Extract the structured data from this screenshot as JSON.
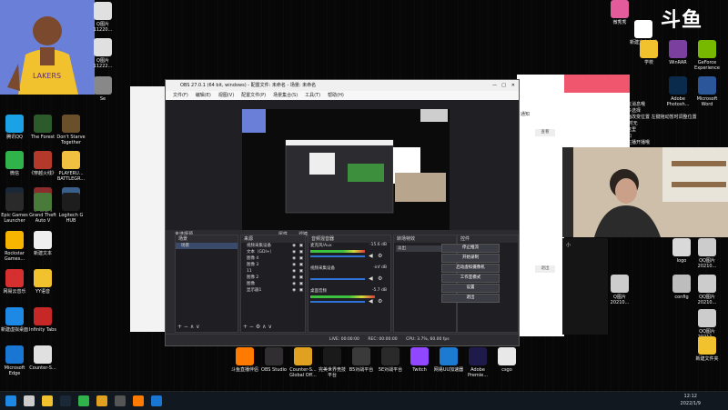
{
  "desktop": {
    "left_icons": [
      {
        "label": "腾讯QQ",
        "color": "#1aa1e6"
      },
      {
        "label": "The Forest",
        "color": "#2d5a2a"
      },
      {
        "label": "Don't Starve Together",
        "color": "#6a4f2b"
      },
      {
        "label": "微信",
        "color": "#2fb34a"
      },
      {
        "label": "《穿越火线》",
        "color": "#b33a2a"
      },
      {
        "label": "PLAYERU... BATTLEGR...",
        "color": "#f0c040"
      },
      {
        "label": "Steam",
        "color": "#1b2838"
      },
      {
        "label": "永劫无间",
        "color": "#8b2c2c"
      },
      {
        "label": "Raft",
        "color": "#3a5f8a"
      },
      {
        "label": "Epic Games Launcher",
        "color": "#2a2a2a"
      },
      {
        "label": "Grand Theft Auto V",
        "color": "#4a7a3a"
      },
      {
        "label": "Logitech G HUB",
        "color": "#1d1d1d"
      },
      {
        "label": "Rockstar Games...",
        "color": "#f7b500"
      },
      {
        "label": "新建文本",
        "color": "#eeeeee"
      },
      {
        "label": "网易云音乐",
        "color": "#d62f2f"
      },
      {
        "label": "YY语音",
        "color": "#f2c12e"
      },
      {
        "label": "新建虚拟桌面",
        "color": "#1e88e5"
      },
      {
        "label": "Infinity Tabs",
        "color": "#c62828"
      },
      {
        "label": "Microsoft Edge",
        "color": "#1976d2"
      },
      {
        "label": "Counter-S...",
        "color": "#e0e0e0"
      }
    ],
    "right_icons": [
      {
        "label": "Q图片 11220...",
        "color": "#e0e0e0"
      },
      {
        "label": "Q图片 11222...",
        "color": "#e0e0e0"
      },
      {
        "label": "Se",
        "color": "#888888"
      },
      {
        "label": "微秀秀",
        "color": "#e35b9a"
      },
      {
        "label": "新建文本文档",
        "color": "#ffffff"
      },
      {
        "label": "学校",
        "color": "#f2c12e"
      },
      {
        "label": "WinRAR",
        "color": "#7b3fa0"
      },
      {
        "label": "GeForce Experience",
        "color": "#76b900"
      },
      {
        "label": "图片编辑",
        "color": "#e53935"
      },
      {
        "label": "Adobe Photosh...",
        "color": "#0b2b4d"
      },
      {
        "label": "Microsoft Word",
        "color": "#2b579a"
      },
      {
        "label": "logo",
        "color": "#d9d9d9"
      },
      {
        "label": "QQ图片 20210...",
        "color": "#cccccc"
      },
      {
        "label": "config",
        "color": "#bdbdbd"
      },
      {
        "label": "QQ图片 20210...",
        "color": "#cccccc"
      },
      {
        "label": "Q图片 20210...",
        "color": "#cccccc"
      },
      {
        "label": "QQ图片 20211...",
        "color": "#cccccc"
      },
      {
        "label": "新建文件夹",
        "color": "#f2c12e"
      }
    ],
    "bottom_icons": [
      {
        "label": "斗鱼直播伴侣",
        "color": "#ff7a00"
      },
      {
        "label": "OBS Studio",
        "color": "#302e31"
      },
      {
        "label": "Counter-S... Global Off...",
        "color": "#e0a020"
      },
      {
        "label": "完美世界竞技 平台",
        "color": "#1a1a1a"
      },
      {
        "label": "B5对战平台",
        "color": "#3a3a3a"
      },
      {
        "label": "5E对战平台",
        "color": "#2a2a2a"
      },
      {
        "label": "Twitch",
        "color": "#9146ff"
      },
      {
        "label": "网易UU加速器",
        "color": "#1c7bd0"
      },
      {
        "label": "Adobe Premie...",
        "color": "#1e1a4a"
      },
      {
        "label": "csgo",
        "color": "#e8e8e8"
      }
    ]
  },
  "chat": {
    "lines": [
      "这里展示水友消息哦",
      "在侧边栏更多选择",
      "左侧进入页面改变位置 左键拖动暂时调整位置",
      "当前状态 暂时无",
      "还是展示在这里",
      "在线直播窗口",
      "开播后显示主播开播哦"
    ]
  },
  "brand": {
    "douyu": "斗鱼"
  },
  "obs": {
    "title": "OBS 27.0.1 (64 bit, windows) - 配置文件: 未命名 - 场景: 未命名",
    "menu": [
      "文件(F)",
      "编辑(E)",
      "视图(V)",
      "配置文件(P)",
      "场景集合(S)",
      "工具(T)",
      "帮助(H)"
    ],
    "no_source": "未选择源",
    "properties": "属性",
    "filters": "滤镜",
    "scenes_header": "场景",
    "scene_items": [
      "场景"
    ],
    "sources_header": "来源",
    "sources": [
      "视频采集设备",
      "文本（GDI+）",
      "图像 4",
      "图像 3",
      "11",
      "图像 2",
      "图像",
      "显示器1"
    ],
    "mixer_header": "音频混音器",
    "mixer": [
      {
        "name": "麦克风/Aux",
        "db": "-15.6 dB",
        "level": 0.72
      },
      {
        "name": "视频采集设备",
        "db": "-inf dB",
        "level": 0.0
      },
      {
        "name": "桌面音频",
        "db": "-5.7 dB",
        "level": 0.84
      }
    ],
    "transitions_header": "转场特效",
    "transition_value": "淡出",
    "controls_header": "控件",
    "controls": [
      "停止推流",
      "开始录制",
      "启动虚拟摄像机",
      "工作室模式",
      "设置",
      "退出"
    ],
    "status": {
      "live": "LIVE: 00:00:00",
      "rec": "REC: 00:00:00",
      "cpu": "CPU: 3.7%, 60.00 fps"
    }
  },
  "qq_panel": {
    "title": "通知",
    "items": [
      "查看",
      "退出"
    ],
    "time_label": "小"
  },
  "taskbar": {
    "time": "12:12",
    "date": "2022/1/9",
    "pinned": [
      {
        "name": "windows",
        "color": "#1e88e5"
      },
      {
        "name": "search",
        "color": "#cccccc"
      },
      {
        "name": "explorer",
        "color": "#f2c12e"
      },
      {
        "name": "steam",
        "color": "#1b2838"
      },
      {
        "name": "wechat",
        "color": "#2fb34a"
      },
      {
        "name": "csgo",
        "color": "#e0a020"
      },
      {
        "name": "obs",
        "color": "#555555"
      },
      {
        "name": "douyu",
        "color": "#ff7a00"
      },
      {
        "name": "edge",
        "color": "#1976d2"
      }
    ]
  }
}
